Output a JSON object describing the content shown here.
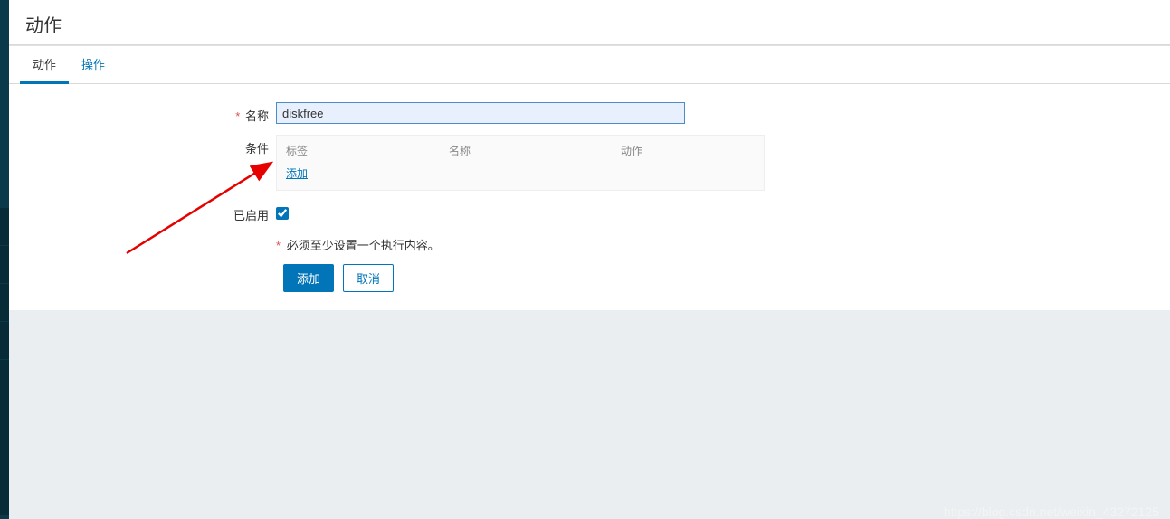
{
  "page": {
    "title": "动作"
  },
  "tabs": [
    {
      "label": "动作",
      "active": true
    },
    {
      "label": "操作",
      "active": false
    }
  ],
  "form": {
    "name_label": "名称",
    "name_value": "diskfree",
    "conditions_label": "条件",
    "conditions_columns": {
      "label": "标签",
      "name": "名称",
      "action": "动作"
    },
    "conditions_add_link": "添加",
    "enabled_label": "已启用",
    "enabled_checked": true,
    "validation_message": "必须至少设置一个执行内容。"
  },
  "buttons": {
    "add": "添加",
    "cancel": "取消"
  },
  "watermark": "https://blog.csdn.net/weixin_43272125"
}
